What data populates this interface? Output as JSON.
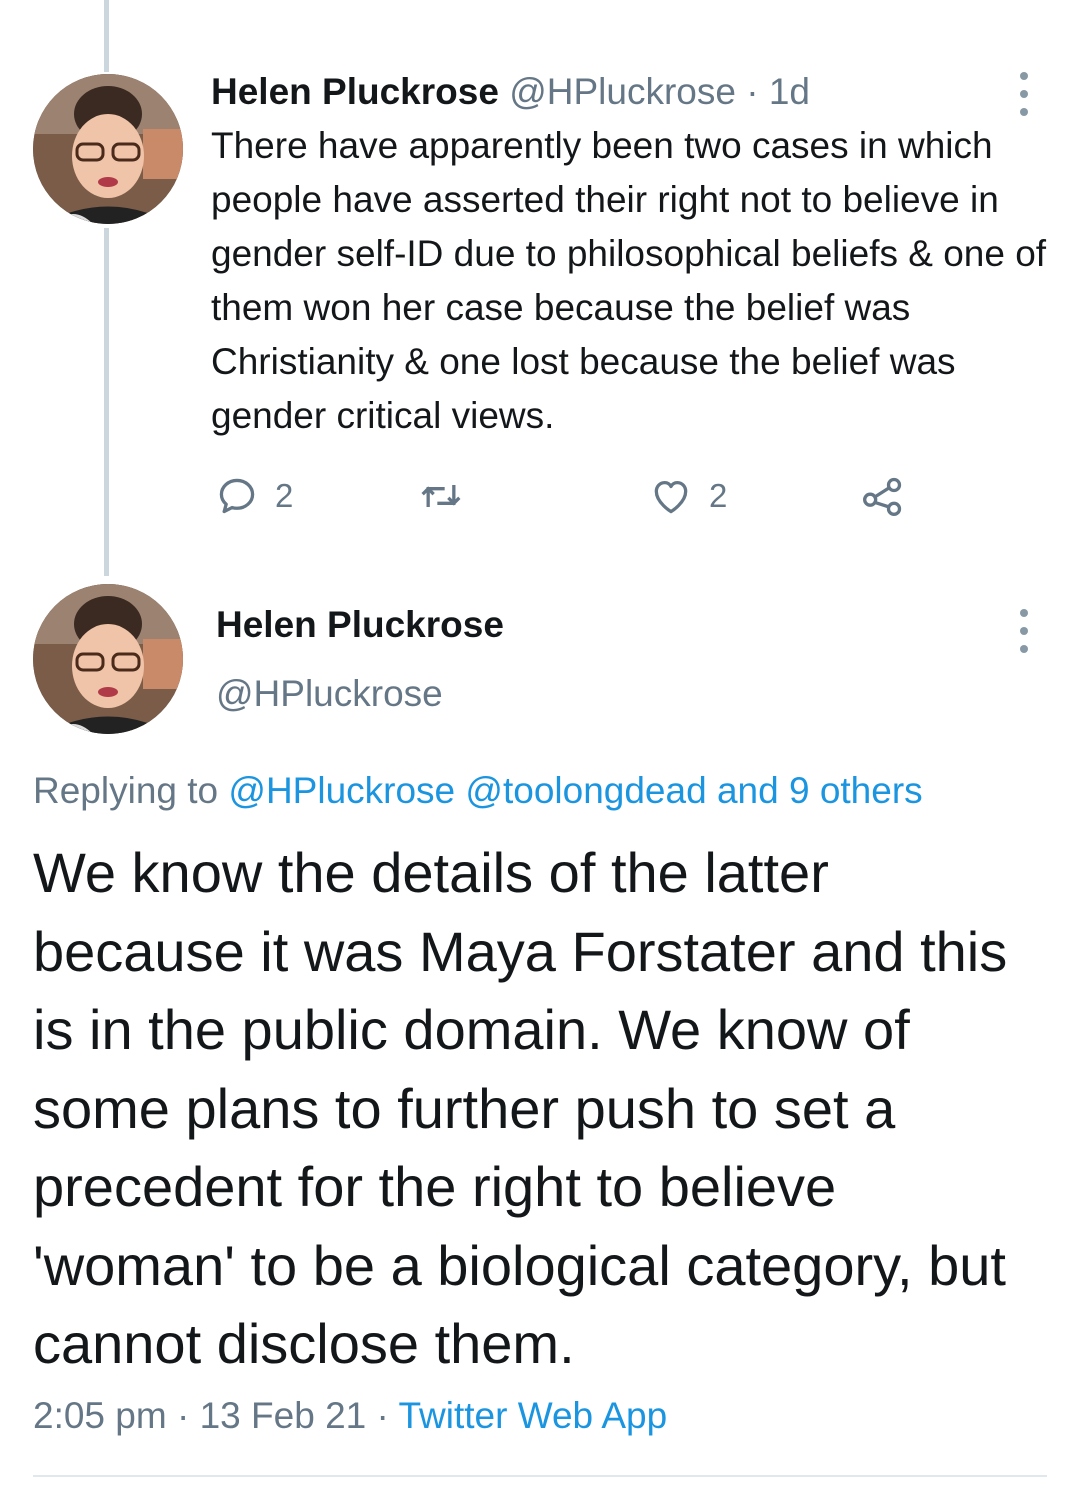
{
  "colors": {
    "text_primary": "#14171a",
    "text_secondary": "#657786",
    "link": "#1b95e0",
    "thread_line": "#ccd6dd"
  },
  "tweet1": {
    "name": "Helen Pluckrose",
    "handle": "@HPluckrose",
    "separator": "·",
    "time": "1d",
    "text": "There have apparently been two cases in which people have asserted their right not to believe in gender self-ID due to philosophical beliefs & one of them won her case because the belief was Christianity & one lost because the belief was gender critical views.",
    "replies": "2",
    "likes": "2",
    "icons": [
      "reply-icon",
      "retweet-icon",
      "like-icon",
      "share-icon",
      "more-icon"
    ]
  },
  "tweet2": {
    "name": "Helen Pluckrose",
    "handle": "@HPluckrose",
    "replying_prefix": "Replying to",
    "replying_to": "@HPluckrose @toolongdead and 9 others",
    "text": "We know the details of the latter because it was Maya Forstater and this is in the public domain. We know of some plans to further push to set a precedent for the right to believe 'woman' to be a biological category, but cannot disclose them.",
    "time": "2:05 pm",
    "date": "13 Feb 21",
    "separator": "·",
    "source": "Twitter Web App"
  }
}
